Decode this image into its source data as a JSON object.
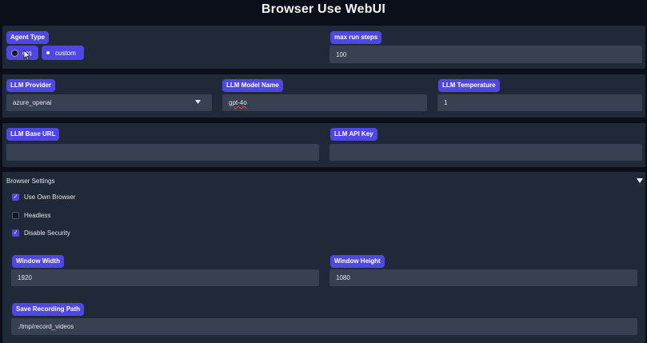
{
  "app": {
    "title": "Browser Use WebUI"
  },
  "agent": {
    "type_label": "Agent Type",
    "options": [
      "org",
      "custom"
    ],
    "selected": "org",
    "max_steps_label": "max run steps",
    "max_steps_value": "100"
  },
  "llm": {
    "provider_label": "LLM Provider",
    "provider_value": "azure_openai",
    "model_label": "LLM Model Name",
    "model_value": "gpt-4o",
    "temperature_label": "LLM Temperature",
    "temperature_value": "1",
    "base_url_label": "LLM Base URL",
    "base_url_value": "",
    "api_key_label": "LLM API Key",
    "api_key_value": ""
  },
  "browser_settings": {
    "title": "Browser Settings",
    "collapse_icon": "triangle-down-icon",
    "use_own_browser_label": "Use Own Browser",
    "use_own_browser": true,
    "headless_label": "Headless",
    "headless": false,
    "disable_security_label": "Disable Security",
    "disable_security": true,
    "window_width_label": "Window Width",
    "window_width_value": "1920",
    "window_height_label": "Window Height",
    "window_height_value": "1080",
    "recording_path_label": "Save Recording Path",
    "recording_path_value": "./tmp/record_videos"
  },
  "colors": {
    "accent": "#4f46e5",
    "panel": "#1f2937",
    "field": "#374151",
    "background": "#0b0f19"
  }
}
